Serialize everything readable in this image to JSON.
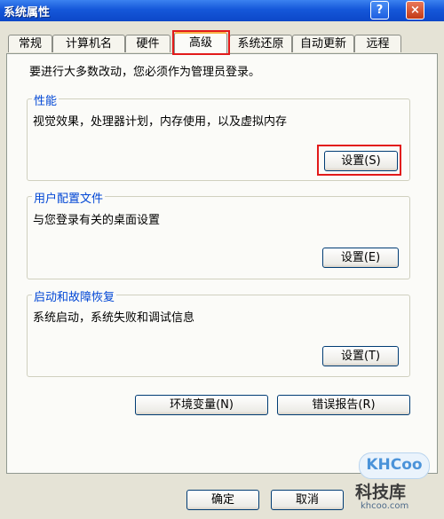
{
  "window": {
    "title": "系统属性",
    "help": "?",
    "close": "×"
  },
  "tabs": [
    "常规",
    "计算机名",
    "硬件",
    "高级",
    "系统还原",
    "自动更新",
    "远程"
  ],
  "admin_note": "要进行大多数改动，您必须作为管理员登录。",
  "groups": {
    "performance": {
      "title": "性能",
      "desc": "视觉效果，处理器计划，内存使用，以及虚拟内存",
      "button": "设置(S)"
    },
    "user_profiles": {
      "title": "用户配置文件",
      "desc": "与您登录有关的桌面设置",
      "button": "设置(E)"
    },
    "startup_recovery": {
      "title": "启动和故障恢复",
      "desc": "系统启动，系统失败和调试信息",
      "button": "设置(T)"
    }
  },
  "bottom_buttons": {
    "env_vars": "环境变量(N)",
    "error_report": "错误报告(R)"
  },
  "dialog_buttons": {
    "ok": "确定",
    "cancel": "取消"
  },
  "watermark": {
    "logo": "KHCoo",
    "name": "科技库",
    "url": "khcoo.com"
  },
  "colors": {
    "titlebar": "#0c47c8",
    "highlight": "#e21a1a",
    "group_title": "#0046d5",
    "dialog_bg": "#e5e3d6"
  }
}
